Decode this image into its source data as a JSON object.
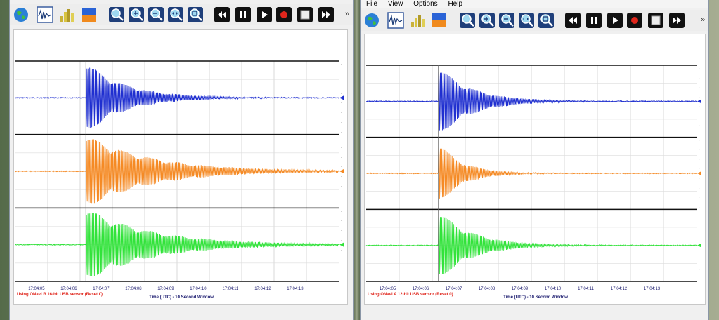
{
  "left_window": {
    "overflow_label": "»",
    "toolbar": [
      {
        "name": "map-globe-button",
        "icon": "globe-icon"
      },
      {
        "name": "waveform-view-button",
        "icon": "waveform-icon"
      },
      {
        "name": "bar-chart-button",
        "icon": "bar-chart-icon"
      },
      {
        "name": "color-layout-button",
        "icon": "color-blocks-icon"
      },
      {
        "name": "zoom-fit-button",
        "icon": "zoom-fit-icon"
      },
      {
        "name": "zoom-in-button",
        "icon": "zoom-in-icon"
      },
      {
        "name": "zoom-out-button",
        "icon": "zoom-out-icon"
      },
      {
        "name": "zoom-horizontal-button",
        "icon": "zoom-horizontal-icon"
      },
      {
        "name": "zoom-reset-button",
        "icon": "zoom-reset-icon"
      },
      {
        "name": "rewind-button",
        "icon": "rewind-icon"
      },
      {
        "name": "pause-button",
        "icon": "pause-icon"
      },
      {
        "name": "play-button",
        "icon": "play-icon"
      },
      {
        "name": "record-button",
        "icon": "record-icon"
      },
      {
        "name": "stop-button",
        "icon": "stop-icon"
      },
      {
        "name": "fast-forward-button",
        "icon": "fast-forward-icon"
      }
    ],
    "time_ticks": [
      "17:04:05",
      "17:04:06",
      "17:04:07",
      "17:04:08",
      "17:04:09",
      "17:04:10",
      "17:04:11",
      "17:04:12",
      "17:04:13"
    ],
    "x_axis_label": "Time (UTC) - 10 Second Window",
    "sensor_label": "Using ONavi B 16-bit USB sensor (Reset 0)",
    "traces": [
      {
        "name": "x-axis-trace",
        "color": "#1f2fd0",
        "onset": 0.22,
        "amp": 0.96,
        "decay": 0.12
      },
      {
        "name": "y-axis-trace",
        "color": "#f58a24",
        "onset": 0.22,
        "amp": 0.98,
        "decay": 0.2
      },
      {
        "name": "z-axis-trace",
        "color": "#31e33a",
        "onset": 0.22,
        "amp": 0.98,
        "decay": 0.2
      }
    ]
  },
  "right_window": {
    "menu": [
      "File",
      "View",
      "Options",
      "Help"
    ],
    "overflow_label": "»",
    "toolbar": [
      {
        "name": "map-globe-button",
        "icon": "globe-icon"
      },
      {
        "name": "waveform-view-button",
        "icon": "waveform-icon"
      },
      {
        "name": "bar-chart-button",
        "icon": "bar-chart-icon"
      },
      {
        "name": "color-layout-button",
        "icon": "color-blocks-icon"
      },
      {
        "name": "zoom-fit-button",
        "icon": "zoom-fit-icon"
      },
      {
        "name": "zoom-in-button",
        "icon": "zoom-in-icon"
      },
      {
        "name": "zoom-out-button",
        "icon": "zoom-out-icon"
      },
      {
        "name": "zoom-horizontal-button",
        "icon": "zoom-horizontal-icon"
      },
      {
        "name": "zoom-reset-button",
        "icon": "zoom-reset-icon"
      },
      {
        "name": "rewind-button",
        "icon": "rewind-icon"
      },
      {
        "name": "pause-button",
        "icon": "pause-icon"
      },
      {
        "name": "play-button",
        "icon": "play-icon"
      },
      {
        "name": "record-button",
        "icon": "record-icon"
      },
      {
        "name": "stop-button",
        "icon": "stop-icon"
      },
      {
        "name": "fast-forward-button",
        "icon": "fast-forward-icon"
      }
    ],
    "time_ticks": [
      "17:04:05",
      "17:04:06",
      "17:04:07",
      "17:04:08",
      "17:04:09",
      "17:04:10",
      "17:04:11",
      "17:04:12",
      "17:04:13"
    ],
    "x_axis_label": "Time (UTC) - 10 Second Window",
    "sensor_label": "Using ONavi A 12-bit USB sensor (Reset 0)",
    "traces": [
      {
        "name": "x-axis-trace",
        "color": "#1f2fd0",
        "onset": 0.22,
        "amp": 0.96,
        "decay": 0.1
      },
      {
        "name": "y-axis-trace",
        "color": "#f58a24",
        "onset": 0.22,
        "amp": 0.85,
        "decay": 0.07
      },
      {
        "name": "z-axis-trace",
        "color": "#31e33a",
        "onset": 0.22,
        "amp": 0.96,
        "decay": 0.1
      }
    ]
  },
  "colors": {
    "accent_red": "#e0261c",
    "axis_text": "#1a1a6e"
  }
}
